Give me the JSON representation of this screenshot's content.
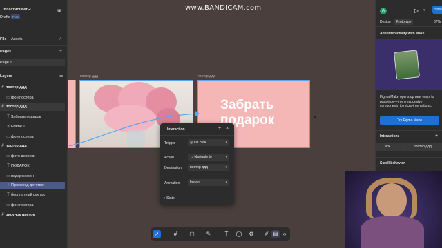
{
  "left": {
    "file_title": "…пластисцветы",
    "drafts": "Drafts",
    "plan_badge": "Free",
    "tab_file": "File",
    "tab_assets": "Assets",
    "pages_header": "Pages",
    "page1": "Page 1",
    "layers_header": "Layers",
    "layers": [
      {
        "label": "постер ддд",
        "bold": true,
        "indent": 0,
        "icon": "#"
      },
      {
        "label": "фон постера",
        "bold": false,
        "indent": 1,
        "icon": "▭"
      },
      {
        "label": "постер ддд",
        "bold": true,
        "indent": 0,
        "icon": "#",
        "selected": true
      },
      {
        "label": "Забрать подарок",
        "bold": false,
        "indent": 1,
        "icon": "T"
      },
      {
        "label": "Frame 1",
        "bold": false,
        "indent": 1,
        "icon": "#"
      },
      {
        "label": "фон постера",
        "bold": false,
        "indent": 1,
        "icon": "▭"
      },
      {
        "label": "постер ддд",
        "bold": true,
        "indent": 0,
        "icon": "#"
      },
      {
        "label": "фото девочки",
        "bold": false,
        "indent": 1,
        "icon": "▭"
      },
      {
        "label": "ПОДАРОК",
        "bold": false,
        "indent": 1,
        "icon": "T"
      },
      {
        "label": "подарок фон",
        "bold": false,
        "indent": 1,
        "icon": "▭"
      },
      {
        "label": "Промокод детство",
        "bold": false,
        "indent": 1,
        "icon": "T",
        "highlight": true
      },
      {
        "label": "бесплатный цветок",
        "bold": false,
        "indent": 1,
        "icon": "T"
      },
      {
        "label": "фон постера",
        "bold": false,
        "indent": 1,
        "icon": "▭"
      },
      {
        "label": "рисунок цветок",
        "bold": true,
        "indent": 0,
        "icon": "#"
      }
    ]
  },
  "canvas": {
    "watermark": "www.BANDICAM.com",
    "frame_label_1": "постер ддд",
    "frame_label_2": "постер ддд",
    "big_text_line1": "Забрать",
    "big_text_line2": "подарок"
  },
  "popup": {
    "title": "Interaction",
    "trigger_label": "Trigger",
    "trigger_value": "On click",
    "action_label": "Action",
    "action_value": "Navigate to",
    "destination_label": "Destination",
    "destination_value": "постер ддд",
    "animation_label": "Animation",
    "animation_value": "Instant",
    "state_label": "State"
  },
  "right": {
    "avatar": "A",
    "share": "Share",
    "tab_design": "Design",
    "tab_prototype": "Prototype",
    "zoom": "37%",
    "make_header": "Add interactivity with Make",
    "make_desc": "Figma Make opens up new ways to prototype—from responsive components to micro-interactions.",
    "make_button": "Try Figma Make",
    "interactions_header": "Interactions",
    "interaction_trigger": "Click",
    "interaction_dest": "постер ддд",
    "scroll_header": "Scroll behavior",
    "accent": "#1e6fd6"
  }
}
